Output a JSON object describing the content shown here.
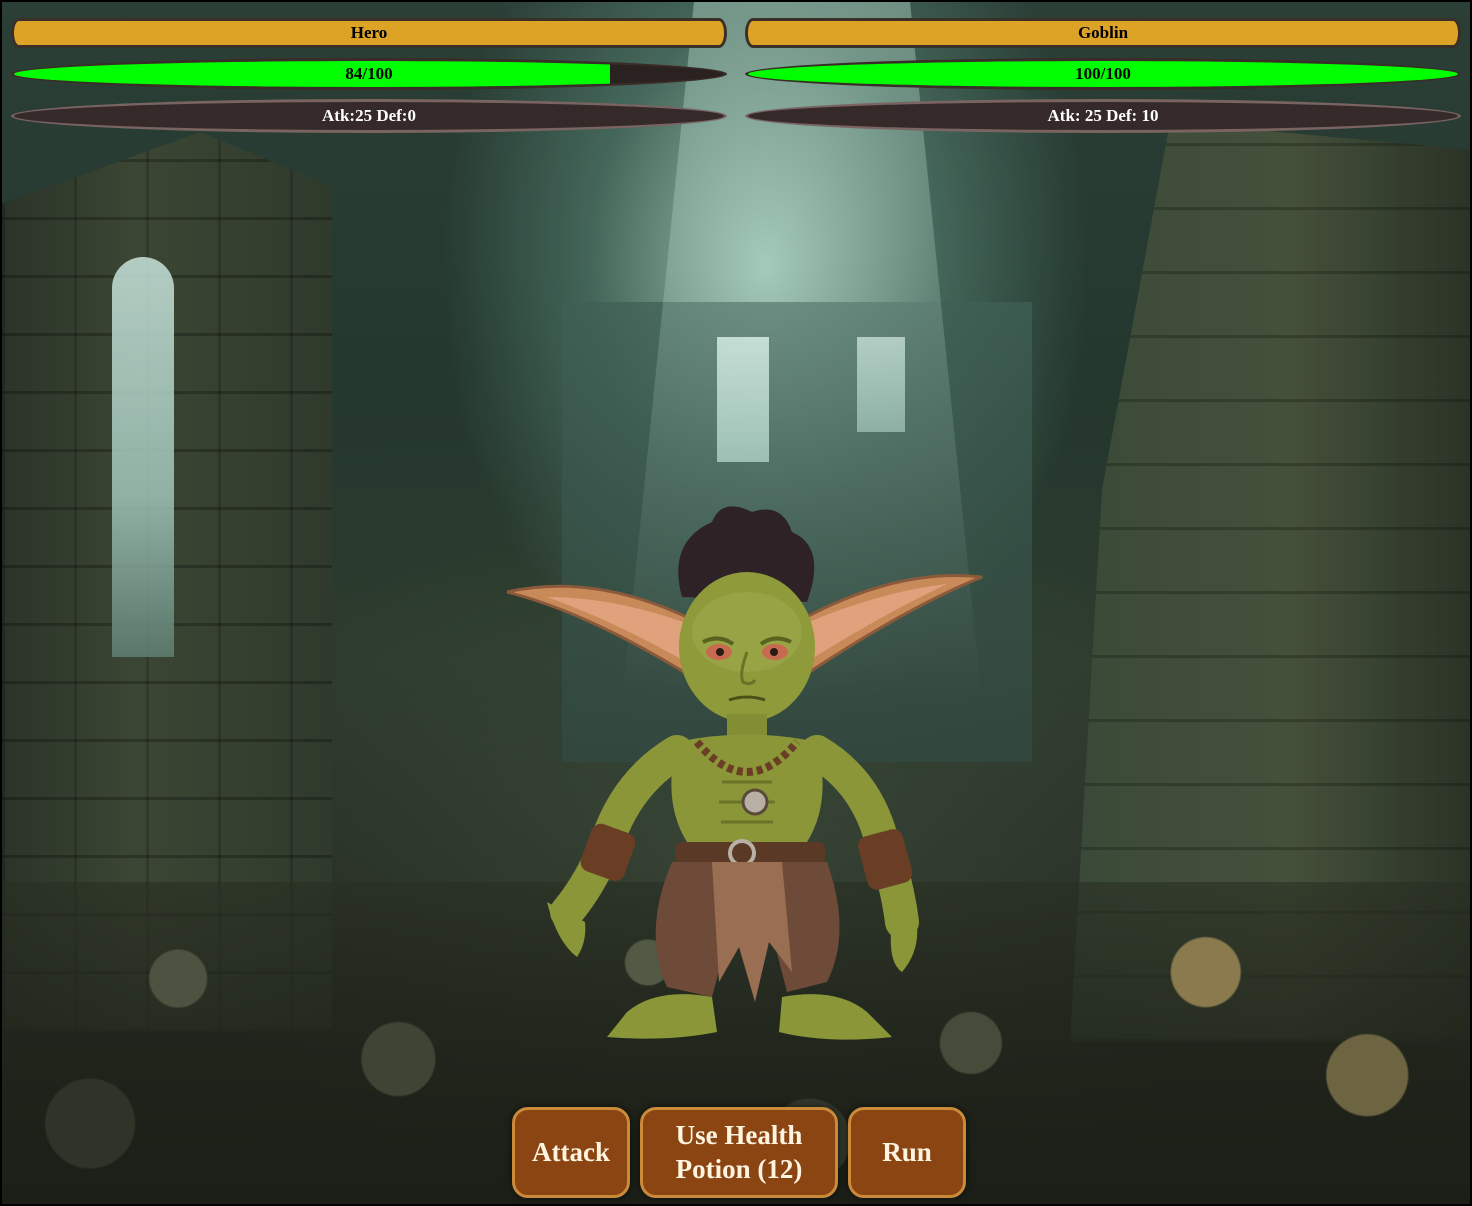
{
  "hero": {
    "name": "Hero",
    "hp_text": "84/100",
    "hp_current": 84,
    "hp_max": 100,
    "stats": "Atk:25 Def:0"
  },
  "enemy": {
    "name": "Goblin",
    "hp_text": "100/100",
    "hp_current": 100,
    "hp_max": 100,
    "stats": "Atk: 25 Def: 10"
  },
  "actions": {
    "attack_label": "Attack",
    "potion_label": "Use Health\nPotion (12)",
    "run_label": "Run"
  },
  "colors": {
    "name_bar": "#dca326",
    "hp_fill": "#00ff00",
    "stat_bar": "#35292a",
    "button": "#8b4513"
  },
  "scene": {
    "background": "ruined-dungeon",
    "enemy_sprite": "goblin"
  }
}
